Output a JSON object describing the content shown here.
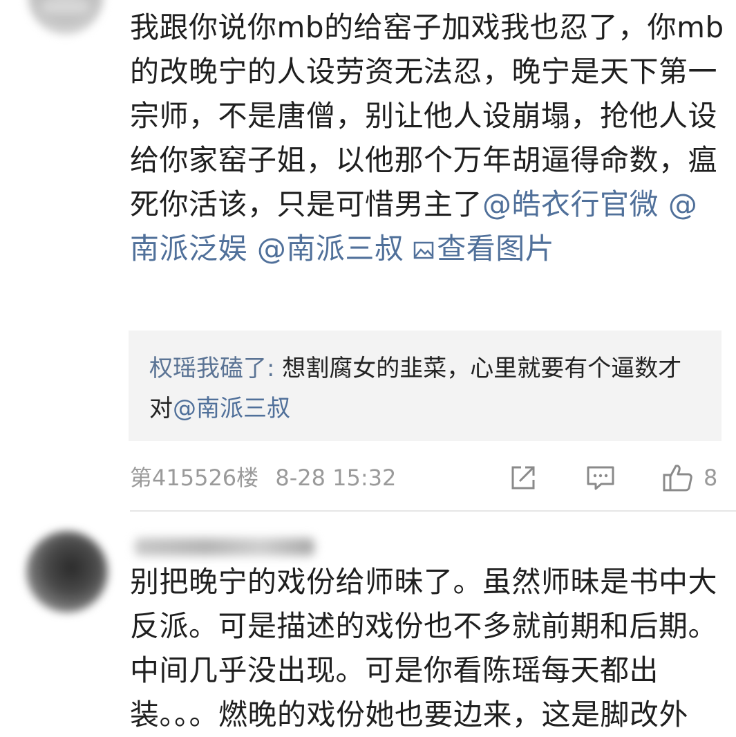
{
  "comments": [
    {
      "body_parts": [
        {
          "text": "我跟你说你mb的给窑子加戏我也忍了，你mb的改晚宁的人设劳资无法忍，晚宁是天下第一宗师，不是唐僧，别让他人设崩塌，抢他人设给你家窑子姐，以他那个万年胡逼得命数，瘟死你活该，只是可惜男主了",
          "type": "text"
        },
        {
          "text": "@皓衣行官微",
          "type": "mention"
        },
        {
          "text": " ",
          "type": "text"
        },
        {
          "text": "@南派泛娱",
          "type": "mention"
        },
        {
          "text": " ",
          "type": "text"
        },
        {
          "text": "@南派三叔",
          "type": "mention"
        },
        {
          "text": " ",
          "type": "text"
        },
        {
          "text": "查看图片",
          "type": "link",
          "icon": "image-icon"
        }
      ],
      "reply": {
        "user": "权瑶我磕了",
        "separator": ": ",
        "text": "想割腐女的韭菜，心里就要有个逼数才对",
        "mention": "@南派三叔"
      },
      "floor": "第415526楼",
      "time": "8-28 15:32",
      "actions": {
        "share_icon": "share-icon",
        "comment_icon": "comment-icon",
        "like_icon": "thumbs-up-icon",
        "like_count": "8"
      }
    },
    {
      "body_parts": [
        {
          "text": "别把晚宁的戏份给师昧了。虽然师昧是书中大反派。可是描述的戏份也不多就前期和后期。中间几乎没出现。可是你看陈瑶每天都出装。。。燃晚的戏份她也要边来，这是脚改外",
          "type": "text"
        }
      ]
    }
  ],
  "colors": {
    "mention": "#50709a",
    "reply_bg": "#f3f3f3",
    "meta_text": "#9a9a9a",
    "body_text": "#1f1f1f"
  }
}
